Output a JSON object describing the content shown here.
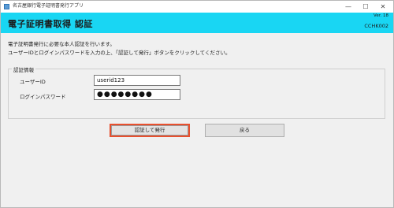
{
  "window": {
    "app_title": "名古屋銀行電子証明書発行アプリ",
    "minimize": "—",
    "maximize": "☐",
    "close": "✕"
  },
  "header": {
    "title": "電子証明書取得  認証",
    "version": "Ver. 18",
    "screen_id": "CCHK002"
  },
  "intro": {
    "line1": "電子証明書発行に必要な本人認証を行います。",
    "line2": "ユーザーIDとログインパスワードを入力の上、「認証して発行」ボタンをクリックしてください。"
  },
  "auth_group": {
    "legend": "認証情報",
    "user_id_label": "ユーザーID",
    "user_id_value": "userid123",
    "password_label": "ログインパスワード",
    "password_value": "●●●●●●●●"
  },
  "actions": {
    "authenticate_label": "認証して発行",
    "back_label": "戻る"
  },
  "colors": {
    "header_band": "#19d6f3",
    "focus_border": "#e8502e"
  }
}
